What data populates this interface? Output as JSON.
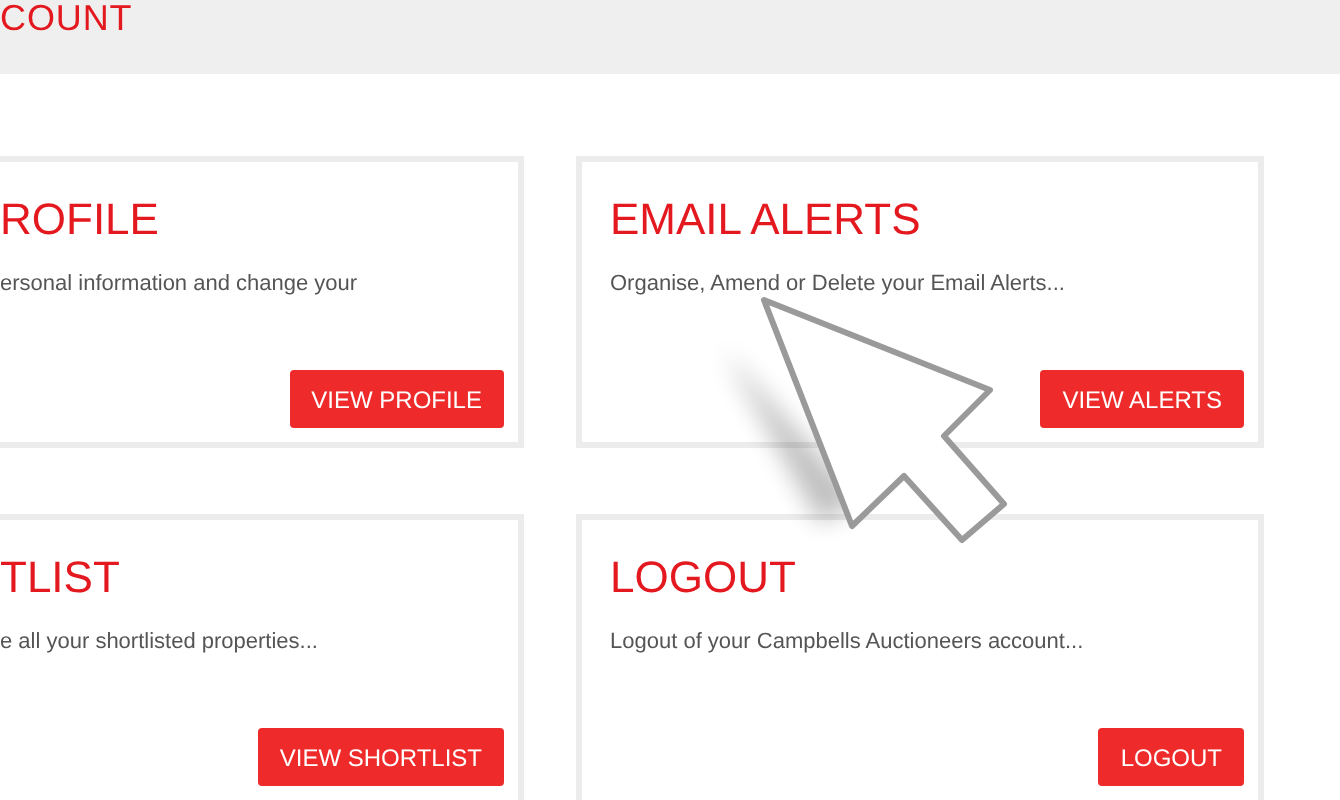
{
  "header": {
    "title": "COUNT"
  },
  "cards": [
    {
      "title": "ROFILE",
      "description": "ersonal information and change your",
      "button": "VIEW PROFILE"
    },
    {
      "title": "EMAIL ALERTS",
      "description": "Organise, Amend or Delete your Email Alerts...",
      "button": "VIEW ALERTS"
    },
    {
      "title": "TLIST",
      "description": "e all your shortlisted properties...",
      "button": "VIEW SHORTLIST"
    },
    {
      "title": "LOGOUT",
      "description": "Logout of your Campbells Auctioneers account...",
      "button": "LOGOUT"
    }
  ]
}
